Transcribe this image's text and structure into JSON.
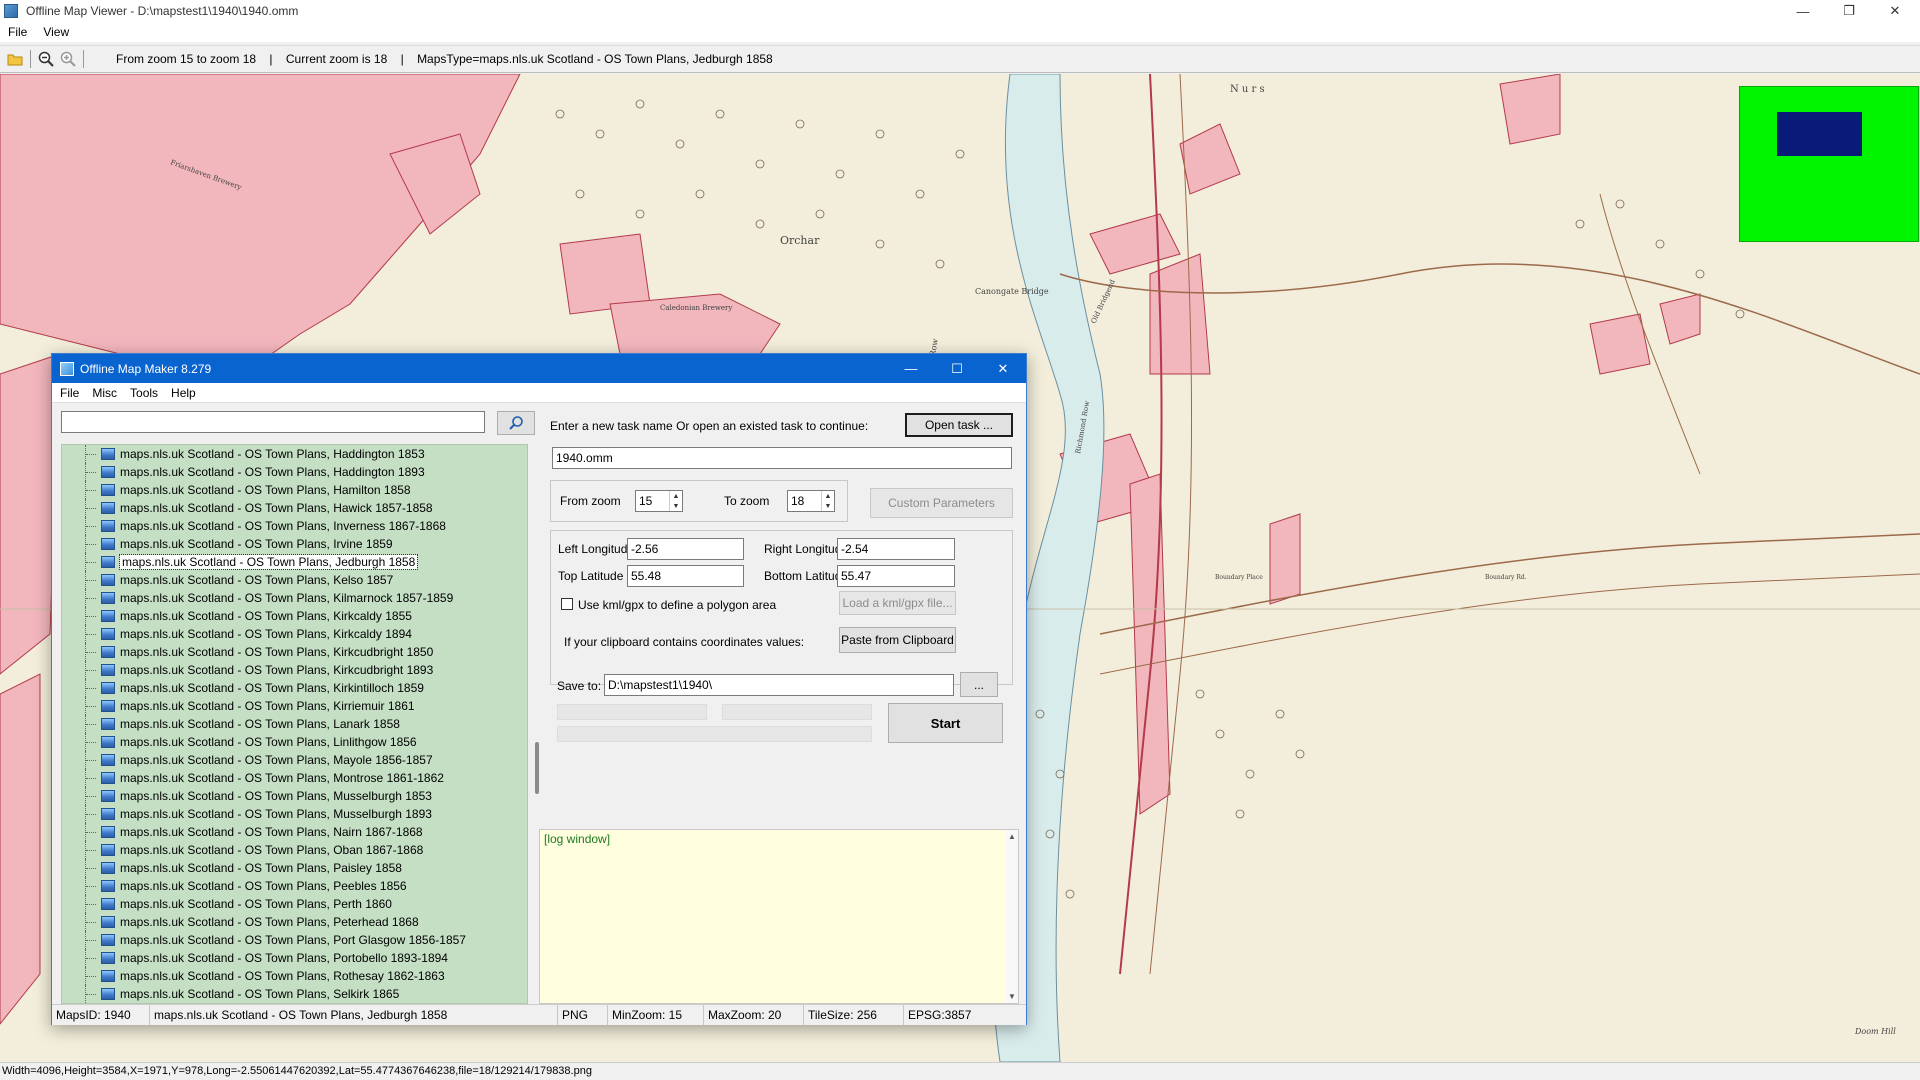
{
  "window": {
    "title": "Offline Map Viewer - D:\\mapstest1\\1940\\1940.omm",
    "minimize": "—",
    "restore": "❐",
    "close": "✕"
  },
  "menu": [
    "File",
    "View"
  ],
  "toolbar": {
    "zoom_range": "From zoom 15 to zoom 18",
    "sep1": "|",
    "current_zoom": "Current zoom is 18",
    "sep2": "|",
    "maps_type": "MapsType=maps.nls.uk Scotland - OS Town Plans, Jedburgh 1858"
  },
  "map": {
    "labels": [
      "N u r s",
      "Orchar",
      "Canongate Bridge",
      "Caledonian Brewery",
      "Friarshaven Brewery",
      "Boundary Rd.",
      "Boundary Place",
      "Deans Row",
      "Richmond Row",
      "Old Bridgend",
      "Doom Hill"
    ],
    "minimap_color": "#00f500",
    "viewport_color": "#0a1a78"
  },
  "statusbar": "Width=4096,Height=3584,X=1971,Y=978,Long=-2.55061447620392,Lat=55.4774367646238,file=18/129214/179838.png",
  "dialog": {
    "title": "Offline Map Maker 8.279",
    "minimize": "—",
    "maximize": "☐",
    "close": "✕",
    "menu": [
      "File",
      "Misc",
      "Tools",
      "Help"
    ],
    "search_value": "",
    "maps": [
      "maps.nls.uk Scotland - OS Town Plans, Haddington 1853",
      "maps.nls.uk Scotland - OS Town Plans, Haddington 1893",
      "maps.nls.uk Scotland - OS Town Plans, Hamilton 1858",
      "maps.nls.uk Scotland - OS Town Plans, Hawick 1857-1858",
      "maps.nls.uk Scotland - OS Town Plans, Inverness 1867-1868",
      "maps.nls.uk Scotland - OS Town Plans, Irvine 1859",
      "maps.nls.uk Scotland - OS Town Plans, Jedburgh 1858",
      "maps.nls.uk Scotland - OS Town Plans, Kelso 1857",
      "maps.nls.uk Scotland - OS Town Plans, Kilmarnock 1857-1859",
      "maps.nls.uk Scotland - OS Town Plans, Kirkcaldy 1855",
      "maps.nls.uk Scotland - OS Town Plans, Kirkcaldy 1894",
      "maps.nls.uk Scotland - OS Town Plans, Kirkcudbright 1850",
      "maps.nls.uk Scotland - OS Town Plans, Kirkcudbright 1893",
      "maps.nls.uk Scotland - OS Town Plans, Kirkintilloch 1859",
      "maps.nls.uk Scotland - OS Town Plans, Kirriemuir 1861",
      "maps.nls.uk Scotland - OS Town Plans, Lanark 1858",
      "maps.nls.uk Scotland - OS Town Plans, Linlithgow 1856",
      "maps.nls.uk Scotland - OS Town Plans, Mayole 1856-1857",
      "maps.nls.uk Scotland - OS Town Plans, Montrose 1861-1862",
      "maps.nls.uk Scotland - OS Town Plans, Musselburgh 1853",
      "maps.nls.uk Scotland - OS Town Plans, Musselburgh 1893",
      "maps.nls.uk Scotland - OS Town Plans, Nairn 1867-1868",
      "maps.nls.uk Scotland - OS Town Plans, Oban 1867-1868",
      "maps.nls.uk Scotland - OS Town Plans, Paisley 1858",
      "maps.nls.uk Scotland - OS Town Plans, Peebles 1856",
      "maps.nls.uk Scotland - OS Town Plans, Perth 1860",
      "maps.nls.uk Scotland - OS Town Plans, Peterhead 1868",
      "maps.nls.uk Scotland - OS Town Plans, Port Glasgow 1856-1857",
      "maps.nls.uk Scotland - OS Town Plans, Portobello 1893-1894",
      "maps.nls.uk Scotland - OS Town Plans, Rothesay 1862-1863",
      "maps.nls.uk Scotland - OS Town Plans, Selkirk 1865"
    ],
    "selected_map": "maps.nls.uk Scotland - OS Town Plans, Jedburgh 1858",
    "task_prompt": "Enter a new task name Or open an existed task to continue:",
    "open_task_label": "Open task ...",
    "task_name": "1940.omm",
    "from_zoom_label": "From zoom",
    "from_zoom_value": "15",
    "to_zoom_label": "To zoom",
    "to_zoom_value": "18",
    "custom_params_label": "Custom Parameters",
    "left_lon_label": "Left Longitude",
    "left_lon_value": "-2.56",
    "right_lon_label": "Right Longitude",
    "right_lon_value": "-2.54",
    "top_lat_label": "Top Latitude",
    "top_lat_value": "55.48",
    "bottom_lat_label": "Bottom Latitude",
    "bottom_lat_value": "55.47",
    "kml_check_label": "Use kml/gpx to define a polygon area",
    "kml_checked": false,
    "load_kml_label": "Load a kml/gpx file...",
    "clipboard_prompt": "If your clipboard contains coordinates values:",
    "paste_label": "Paste from Clipboard",
    "save_to_label": "Save to:",
    "save_to_value": "D:\\mapstest1\\1940\\",
    "browse_label": "...",
    "start_label": "Start",
    "log_text": "[log window]",
    "status": {
      "maps_id": "MapsID: 1940",
      "map_name": "maps.nls.uk Scotland - OS Town Plans, Jedburgh 1858",
      "format": "PNG",
      "min_zoom": "MinZoom: 15",
      "max_zoom": "MaxZoom: 20",
      "tile_size": "TileSize: 256",
      "epsg": "EPSG:3857"
    }
  }
}
